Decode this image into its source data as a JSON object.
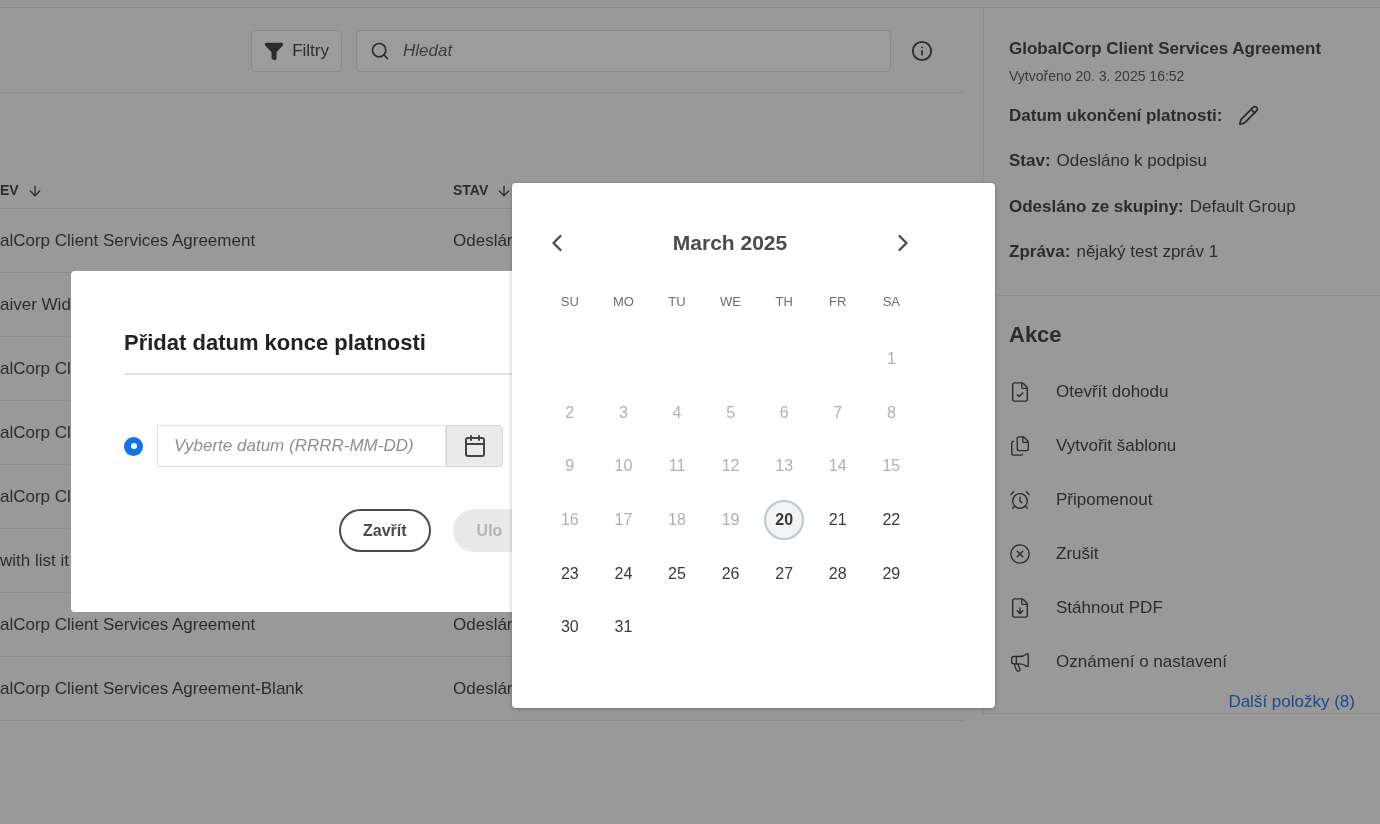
{
  "toolbar": {
    "filter_button": "Filtry",
    "search": {
      "placeholder": "Hledat"
    }
  },
  "table": {
    "columns": [
      {
        "label": "EV"
      },
      {
        "label": "STAV"
      }
    ],
    "rows": [
      {
        "name": "alCorp Client Services Agreement",
        "status": "Odeslán"
      },
      {
        "name": "aiver Wid"
      },
      {
        "name": "alCorp Cl"
      },
      {
        "name": "alCorp Cl"
      },
      {
        "name": "alCorp Cl"
      },
      {
        "name": "with list it"
      },
      {
        "name": "alCorp Client Services Agreement",
        "status": "Odeslár"
      },
      {
        "name": "alCorp Client Services Agreement-Blank",
        "status": "Odeslár"
      }
    ]
  },
  "details": {
    "title": "GlobalCorp Client Services Agreement",
    "created": "Vytvořeno 20. 3. 2025 16:52",
    "expiry_label": "Datum ukončení platnosti:",
    "fields": [
      {
        "label": "Stav:",
        "value": "Odesláno k podpisu"
      },
      {
        "label": "Odesláno ze skupiny:",
        "value": "Default Group"
      },
      {
        "label": "Zpráva:",
        "value": "nějaký test zpráv 1"
      }
    ]
  },
  "actions": {
    "title": "Akce",
    "items": [
      {
        "kind": "open",
        "label": "Otevřít dohodu"
      },
      {
        "kind": "template",
        "label": "Vytvořit šablonu"
      },
      {
        "kind": "remind",
        "label": "Připomenout"
      },
      {
        "kind": "cancel",
        "label": "Zrušit"
      },
      {
        "kind": "pdf",
        "label": "Stáhnout PDF"
      },
      {
        "kind": "notify",
        "label": "Oznámení o nastavení"
      }
    ],
    "more": "Další položky (8)"
  },
  "dialog": {
    "title": "Přidat datum konce platnosti",
    "radio_selected": true,
    "date_field": {
      "placeholder": "Vyberte datum (RRRR-MM-DD)"
    },
    "buttons": [
      {
        "label": "Zavřít",
        "disabled": false
      },
      {
        "label": "Ulo",
        "disabled": true
      }
    ]
  },
  "calendar": {
    "title": "March 2025",
    "weekdays": [
      "SU",
      "MO",
      "TU",
      "WE",
      "TH",
      "FR",
      "SA"
    ],
    "weeks": [
      [
        {
          "day": "1",
          "disabled": true,
          "today": false
        }
      ],
      [
        {
          "day": "2",
          "disabled": true,
          "today": false
        },
        {
          "day": "3",
          "disabled": true,
          "today": false
        },
        {
          "day": "4",
          "disabled": true,
          "today": false
        },
        {
          "day": "5",
          "disabled": true,
          "today": false
        },
        {
          "day": "6",
          "disabled": true,
          "today": false
        },
        {
          "day": "7",
          "disabled": true,
          "today": false
        },
        {
          "day": "8",
          "disabled": true,
          "today": false
        }
      ],
      [
        {
          "day": "9",
          "disabled": true,
          "today": false
        },
        {
          "day": "10",
          "disabled": true,
          "today": false
        },
        {
          "day": "11",
          "disabled": true,
          "today": false
        },
        {
          "day": "12",
          "disabled": true,
          "today": false
        },
        {
          "day": "13",
          "disabled": true,
          "today": false
        },
        {
          "day": "14",
          "disabled": true,
          "today": false
        },
        {
          "day": "15",
          "disabled": true,
          "today": false
        }
      ],
      [
        {
          "day": "16",
          "disabled": true,
          "today": false
        },
        {
          "day": "17",
          "disabled": true,
          "today": false
        },
        {
          "day": "18",
          "disabled": true,
          "today": false
        },
        {
          "day": "19",
          "disabled": true,
          "today": false
        },
        {
          "day": "20",
          "disabled": false,
          "today": true
        },
        {
          "day": "21",
          "disabled": false,
          "today": false
        },
        {
          "day": "22",
          "disabled": false,
          "today": false
        }
      ],
      [
        {
          "day": "23",
          "disabled": false,
          "today": false
        },
        {
          "day": "24",
          "disabled": false,
          "today": false
        },
        {
          "day": "25",
          "disabled": false,
          "today": false
        },
        {
          "day": "26",
          "disabled": false,
          "today": false
        },
        {
          "day": "27",
          "disabled": false,
          "today": false
        },
        {
          "day": "28",
          "disabled": false,
          "today": false
        },
        {
          "day": "29",
          "disabled": false,
          "today": false
        }
      ],
      [
        {
          "day": "30",
          "disabled": false,
          "today": false
        },
        {
          "day": "31",
          "disabled": false,
          "today": false
        }
      ]
    ]
  }
}
